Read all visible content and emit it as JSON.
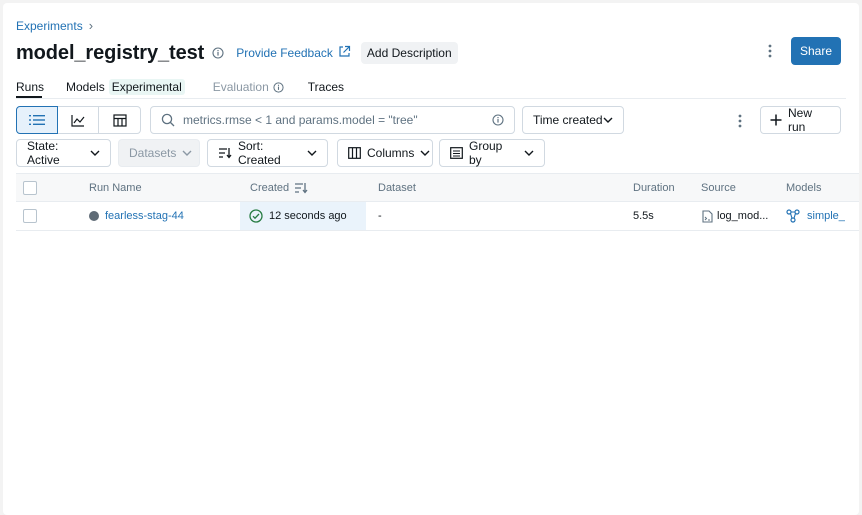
{
  "breadcrumb": {
    "parent": "Experiments",
    "separator": "›"
  },
  "header": {
    "title": "model_registry_test",
    "feedback_label": "Provide Feedback",
    "add_description_label": "Add Description",
    "share_label": "Share"
  },
  "tabs": [
    {
      "label": "Runs",
      "active": true
    },
    {
      "label": "Models",
      "badge": "Experimental"
    },
    {
      "label": "Evaluation",
      "disabled": true
    },
    {
      "label": "Traces"
    }
  ],
  "toolbar": {
    "search_placeholder": "metrics.rmse < 1 and params.model = \"tree\"",
    "sort_select": "Time created",
    "new_run_label": "New run",
    "state_filter": "State: Active",
    "datasets_filter": "Datasets",
    "sort_filter": "Sort: Created",
    "columns_label": "Columns",
    "group_by_label": "Group by"
  },
  "table": {
    "columns": [
      "Run Name",
      "Created",
      "Dataset",
      "Duration",
      "Source",
      "Models"
    ],
    "rows": [
      {
        "run_name": "fearless-stag-44",
        "created": "12 seconds ago",
        "dataset": "-",
        "duration": "5.5s",
        "source": "log_mod...",
        "models": "simple_"
      }
    ]
  },
  "colors": {
    "accent": "#2272b4",
    "success": "#277c43"
  }
}
